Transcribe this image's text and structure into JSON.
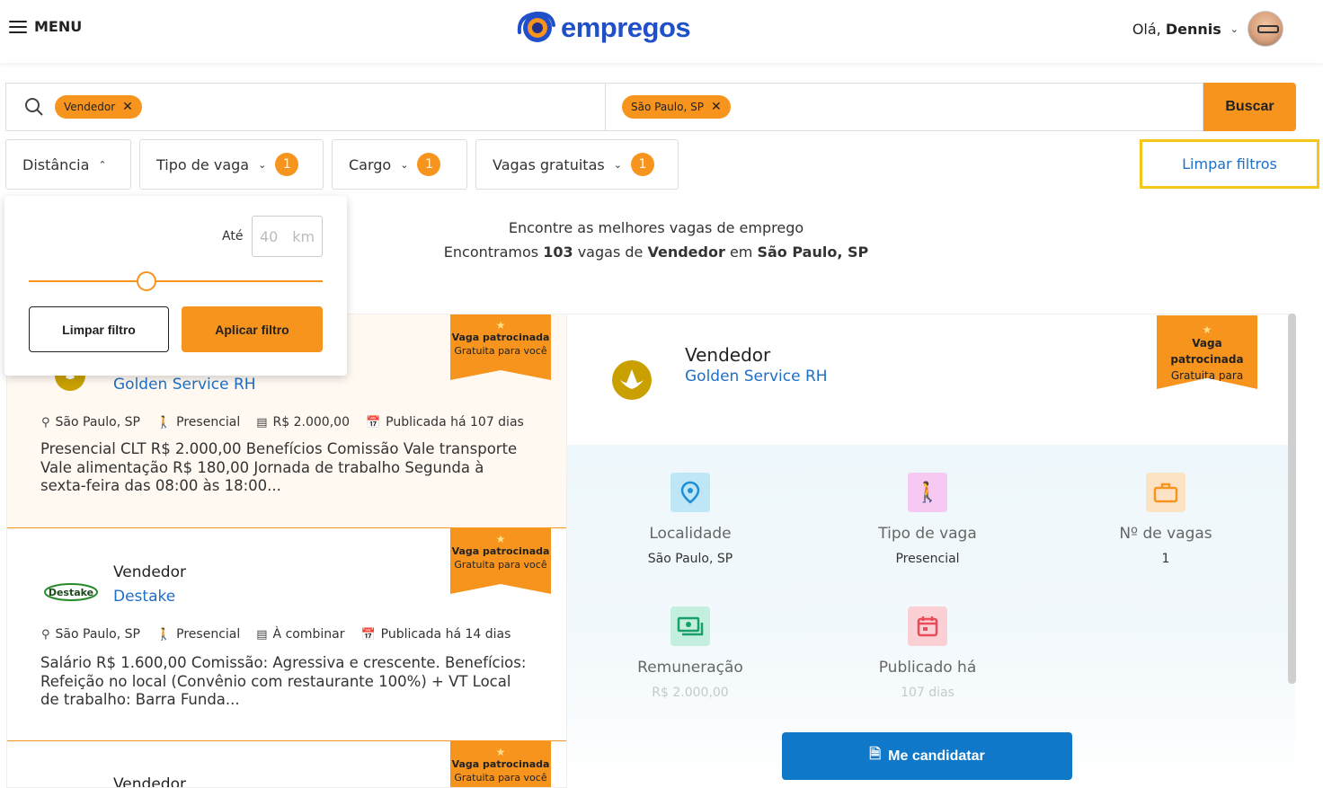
{
  "header": {
    "menu_label": "MENU",
    "logo_text": "empregos",
    "greeting": "Olá,",
    "user_name": "Dennis"
  },
  "search": {
    "keyword_chip": "Vendedor",
    "location_chip": "São Paulo, SP",
    "button_label": "Buscar"
  },
  "filters": {
    "distance": {
      "label": "Distância"
    },
    "job_type": {
      "label": "Tipo de vaga",
      "count": "1"
    },
    "position": {
      "label": "Cargo",
      "count": "1"
    },
    "free_jobs": {
      "label": "Vagas gratuitas",
      "count": "1"
    },
    "clear_all": "Limpar filtros"
  },
  "distance_panel": {
    "up_to_label": "Até",
    "value_placeholder": "40",
    "unit": "km",
    "slider_fraction": 0.4,
    "clear_button": "Limpar filtro",
    "apply_button": "Aplicar filtro"
  },
  "headline": {
    "line1": "Encontre as melhores vagas de emprego",
    "prefix": "Encontramos",
    "count": "103",
    "mid1": "vagas de",
    "keyword": "Vendedor",
    "mid2": "em",
    "location": "São Paulo, SP"
  },
  "sponsor": {
    "line1": "Vaga patrocinada",
    "line2": "Gratuita para você"
  },
  "jobs": [
    {
      "company": "Golden Service RH",
      "location": "São Paulo, SP",
      "modality": "Presencial",
      "salary": "R$ 2.000,00",
      "published": "Publicada há 107 dias",
      "description": "Presencial CLT R$ 2.000,00 Benefícios Comissão Vale transporte Vale alimentação R$ 180,00 Jornada de trabalho Segunda à sexta-feira das 08:00 às 18:00..."
    },
    {
      "title": "Vendedor",
      "company": "Destake",
      "logo_text": "Destake",
      "location": "São Paulo, SP",
      "modality": "Presencial",
      "salary": "À combinar",
      "published": "Publicada há 14 dias",
      "description": "Salário R$ 1.600,00 Comissão: Agressiva e crescente. Benefícios: Refeição no local (Convênio com restaurante 100%) + VT Local de trabalho: Barra Funda..."
    },
    {
      "title": "Vendedor"
    }
  ],
  "detail": {
    "title": "Vendedor",
    "company": "Golden Service RH",
    "items": [
      {
        "label": "Localidade",
        "value": "São Paulo, SP"
      },
      {
        "label": "Tipo de vaga",
        "value": "Presencial"
      },
      {
        "label": "Nº de vagas",
        "value": "1"
      },
      {
        "label": "Remuneração",
        "value": "R$ 2.000,00"
      },
      {
        "label": "Publicado há",
        "value": "107 dias"
      }
    ],
    "apply_button": "Me candidatar"
  },
  "colors": {
    "brand_orange": "#f7941d",
    "brand_blue": "#1f4fc9",
    "link_blue": "#1f6fc5",
    "apply_blue": "#0f78c8",
    "highlight_yellow": "#f5c518"
  }
}
